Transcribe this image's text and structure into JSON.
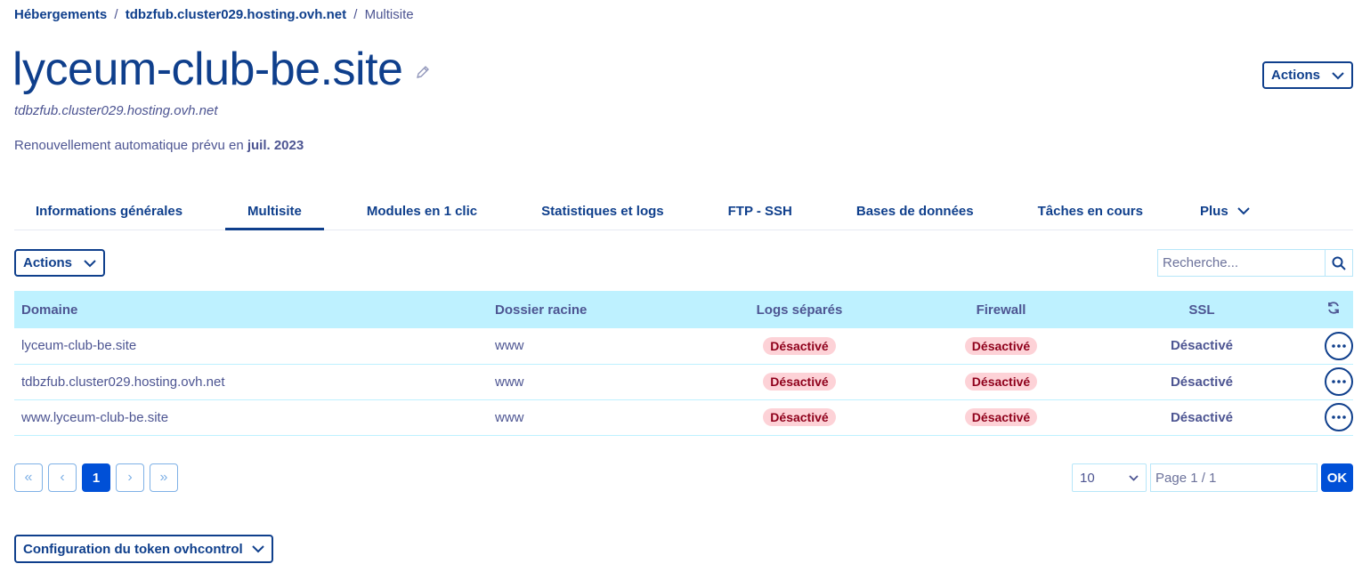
{
  "breadcrumb": {
    "item1": "Hébergements",
    "sep1": "/",
    "item2": "tdbzfub.cluster029.hosting.ovh.net",
    "sep2": "/",
    "current": "Multisite"
  },
  "header": {
    "title": "lyceum-club-be.site",
    "subtitle": "tdbzfub.cluster029.hosting.ovh.net",
    "renew_prefix": "Renouvellement automatique prévu en",
    "renew_date": "juil. 2023",
    "actions_label": "Actions"
  },
  "tabs": [
    {
      "label": "Informations générales",
      "active": false
    },
    {
      "label": "Multisite",
      "active": true
    },
    {
      "label": "Modules en 1 clic",
      "active": false
    },
    {
      "label": "Statistiques et logs",
      "active": false
    },
    {
      "label": "FTP - SSH",
      "active": false
    },
    {
      "label": "Bases de données",
      "active": false
    },
    {
      "label": "Tâches en cours",
      "active": false
    },
    {
      "label": "Plus",
      "active": false
    }
  ],
  "toolbar": {
    "actions_label": "Actions",
    "search_placeholder": "Recherche..."
  },
  "table": {
    "columns": {
      "domain": "Domaine",
      "root": "Dossier racine",
      "logs": "Logs séparés",
      "firewall": "Firewall",
      "ssl": "SSL"
    },
    "rows": [
      {
        "domain": "lyceum-club-be.site",
        "root": "www",
        "logs": "Désactivé",
        "firewall": "Désactivé",
        "ssl": "Désactivé"
      },
      {
        "domain": "tdbzfub.cluster029.hosting.ovh.net",
        "root": "www",
        "logs": "Désactivé",
        "firewall": "Désactivé",
        "ssl": "Désactivé"
      },
      {
        "domain": "www.lyceum-club-be.site",
        "root": "www",
        "logs": "Désactivé",
        "firewall": "Désactivé",
        "ssl": "Désactivé"
      }
    ]
  },
  "pagination": {
    "first": "«",
    "prev": "‹",
    "current": "1",
    "next": "›",
    "last": "»",
    "per_page": "10",
    "page_placeholder": "Page 1 / 1",
    "ok_label": "OK"
  },
  "footer": {
    "token_label": "Configuration du token ovhcontrol"
  },
  "colors": {
    "primary": "#0f3f8c",
    "accent": "#0050d7",
    "table_header_bg": "#bef1ff",
    "badge_bg": "#fdd2d7",
    "badge_text": "#8f001b"
  },
  "icons": [
    "pencil-icon",
    "chevron-down-icon",
    "search-icon",
    "refresh-icon",
    "more-dots-icon"
  ]
}
